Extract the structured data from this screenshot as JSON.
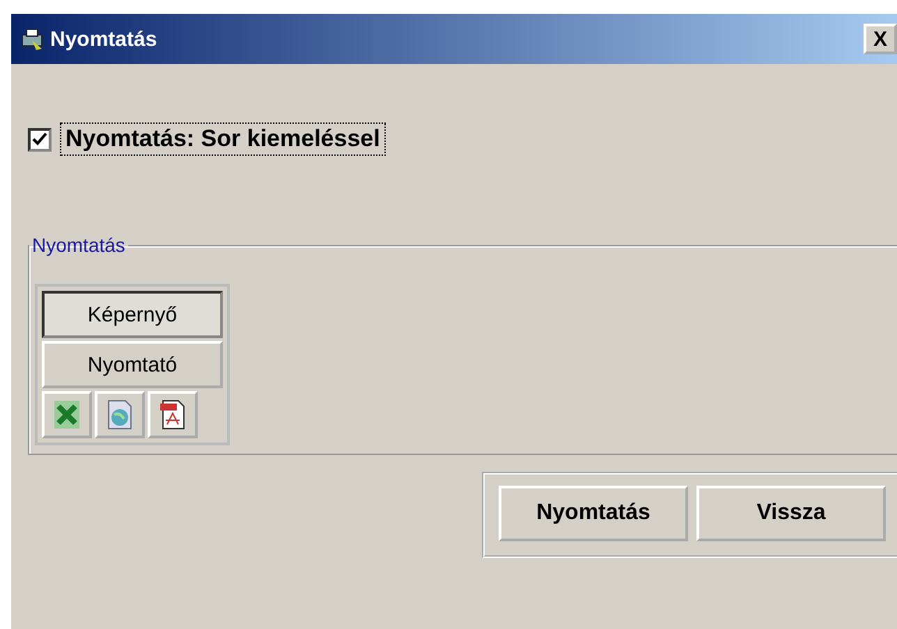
{
  "window": {
    "title": "Nyomtatás",
    "close": "X"
  },
  "option": {
    "label": "Nyomtatás: Sor kiemeléssel",
    "checked": true
  },
  "group": {
    "title": "Nyomtatás",
    "modes": [
      {
        "label": "Képernyő",
        "selected": true
      },
      {
        "label": "Nyomtató",
        "selected": false
      }
    ],
    "exports": [
      {
        "kind": "spreadsheet"
      },
      {
        "kind": "web"
      },
      {
        "kind": "pdf"
      }
    ]
  },
  "buttons": [
    "Nyomtatás",
    "Vissza"
  ]
}
